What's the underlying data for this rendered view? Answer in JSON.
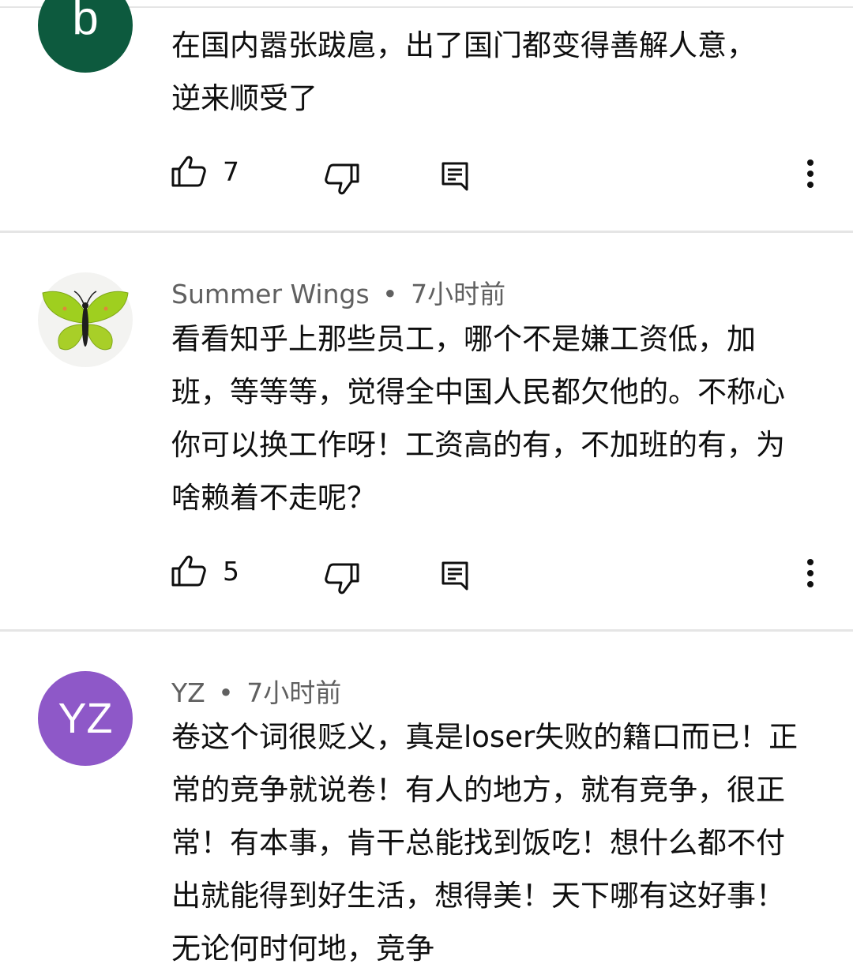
{
  "comments": [
    {
      "avatar_letter": "b",
      "avatar_color": "#0d5a3e",
      "text": "在国内嚣张跋扈，出了国门都变得善解人意，逆来顺受了",
      "likes": "7"
    },
    {
      "author": "Summer Wings",
      "separator": "•",
      "time": "7小时前",
      "avatar_icon": "butterfly-avatar",
      "text": "看看知乎上那些员工，哪个不是嫌工资低，加班，等等等，觉得全中国人民都欠他的。不称心你可以换工作呀！工资高的有，不加班的有，为啥赖着不走呢？",
      "likes": "5"
    },
    {
      "author": "YZ",
      "separator": "•",
      "time": "7小时前",
      "avatar_letter": "YZ",
      "avatar_color": "#8e58c8",
      "text": "卷这个词很贬义，真是loser失败的籍口而已！正常的竞争就说卷！有人的地方，就有竞争，很正常！有本事，肯干总能找到饭吃！想什么都不付出就能得到好生活，想得美！天下哪有这好事！无论何时何地，竞争"
    }
  ],
  "colors": {
    "divider": "#e5e5e5",
    "meta_text": "#606060",
    "body_text": "#0f0f0f"
  }
}
